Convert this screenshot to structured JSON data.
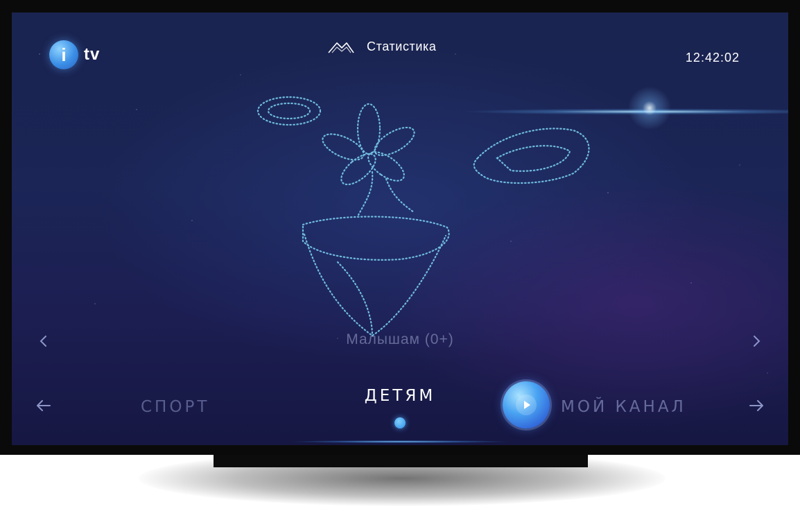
{
  "header": {
    "logo_letter": "i",
    "logo_text": "tv",
    "stats_label": "Статистика",
    "stats_icon": "mountains-icon",
    "clock": "12:42:02"
  },
  "carousel": {
    "subcategory": "Малышам (0+)",
    "categories": [
      "СПОРТ",
      "ДЕТЯМ",
      "МОЙ КАНАЛ"
    ],
    "active_index": 1,
    "play_icon": "play-icon"
  },
  "colors": {
    "accent": "#3b9bf0",
    "background": "#1b2556",
    "inactive_text": "#8c96c8"
  }
}
